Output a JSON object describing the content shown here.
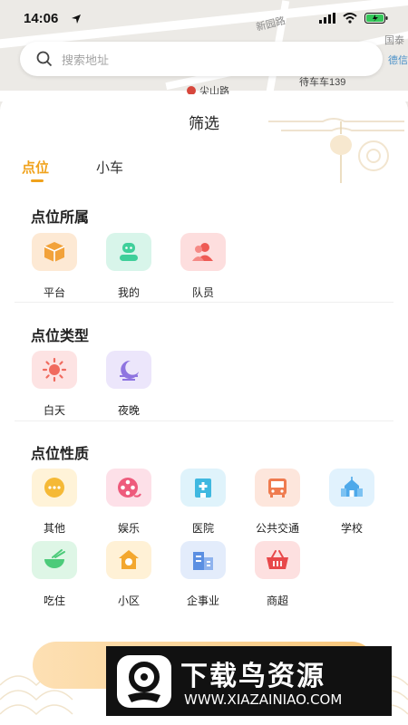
{
  "status_bar": {
    "time": "14:06"
  },
  "map": {
    "labels": [
      "新园路",
      "尖山路",
      "待车车139",
      "国泰",
      "德信"
    ]
  },
  "search": {
    "placeholder": "搜索地址"
  },
  "sheet": {
    "title": "筛选",
    "tabs": [
      {
        "label": "点位",
        "active": true
      },
      {
        "label": "小车",
        "active": false
      }
    ],
    "sections": {
      "ownership": {
        "title": "点位所属",
        "items": [
          {
            "label": "平台",
            "icon": "box-icon",
            "bg": "#fde9d4",
            "color": "#f2a23a"
          },
          {
            "label": "我的",
            "icon": "user-icon",
            "bg": "#d8f5ea",
            "color": "#3fcf9a"
          },
          {
            "label": "队员",
            "icon": "team-icon",
            "bg": "#fddede",
            "color": "#ee5a54"
          }
        ]
      },
      "type": {
        "title": "点位类型",
        "items": [
          {
            "label": "白天",
            "icon": "sun-icon",
            "bg": "#fde3e3",
            "color": "#f06a5e"
          },
          {
            "label": "夜晚",
            "icon": "moon-icon",
            "bg": "#ece6fb",
            "color": "#8e74e0"
          }
        ]
      },
      "nature": {
        "title": "点位性质",
        "items": [
          {
            "label": "其他",
            "icon": "more-icon",
            "bg": "#fff3d8",
            "color": "#f5b936"
          },
          {
            "label": "娱乐",
            "icon": "film-icon",
            "bg": "#fde0e8",
            "color": "#ee5b7c"
          },
          {
            "label": "医院",
            "icon": "hospital-icon",
            "bg": "#dff3fb",
            "color": "#3fb8e0"
          },
          {
            "label": "公共交通",
            "icon": "bus-icon",
            "bg": "#fde6dc",
            "color": "#ef7b4f"
          },
          {
            "label": "学校",
            "icon": "school-icon",
            "bg": "#e1f2fd",
            "color": "#4ea9ea"
          },
          {
            "label": "吃住",
            "icon": "bowl-icon",
            "bg": "#def6e6",
            "color": "#4ccb7a"
          },
          {
            "label": "小区",
            "icon": "house-icon",
            "bg": "#fff1d6",
            "color": "#f3a72e"
          },
          {
            "label": "企事业",
            "icon": "building-icon",
            "bg": "#e3ecfb",
            "color": "#5b8fe2"
          },
          {
            "label": "商超",
            "icon": "basket-icon",
            "bg": "#fde0e0",
            "color": "#e8484a"
          }
        ]
      }
    }
  },
  "watermark": {
    "brand": "下载鸟资源",
    "url": "WWW.XIAZAINIAO.COM"
  },
  "colors": {
    "accent": "#f0a21c"
  }
}
